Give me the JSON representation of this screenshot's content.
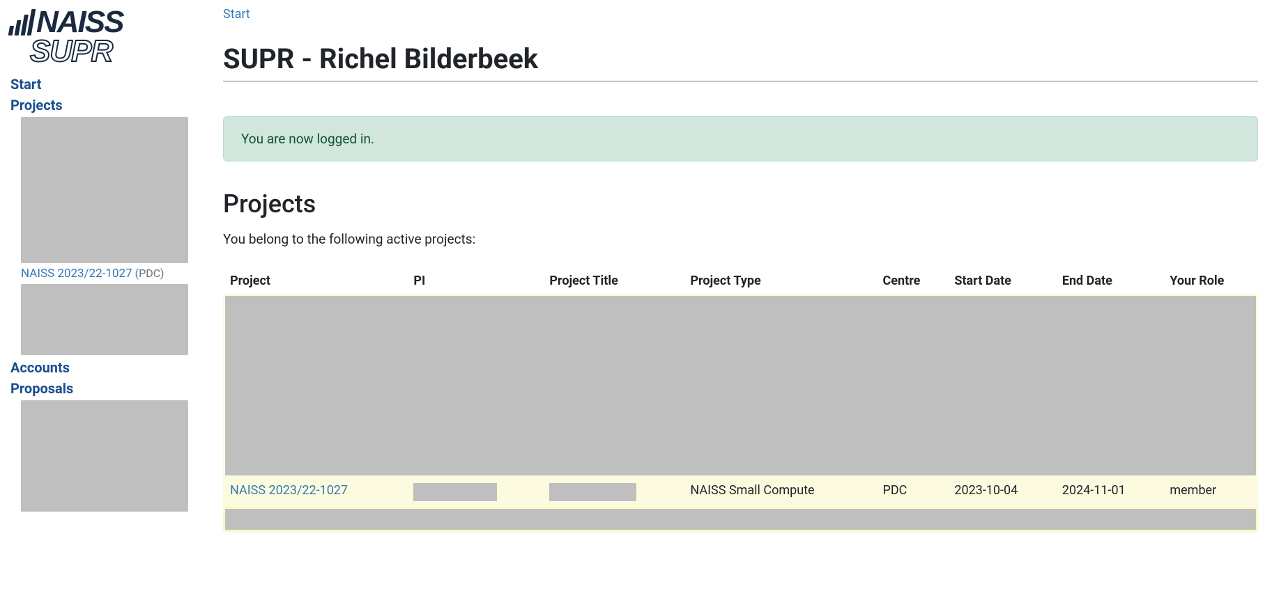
{
  "breadcrumb": {
    "start": "Start"
  },
  "header": {
    "title": "SUPR - Richel Bilderbeek"
  },
  "alert": {
    "message": "You are now logged in."
  },
  "sidebar": {
    "nav_start": "Start",
    "nav_projects": "Projects",
    "project_link": "NAISS 2023/22-1027",
    "project_suffix": "(PDC)",
    "nav_accounts": "Accounts",
    "nav_proposals": "Proposals"
  },
  "projects": {
    "title": "Projects",
    "description": "You belong to the following active projects:",
    "columns": {
      "project": "Project",
      "pi": "PI",
      "title": "Project Title",
      "type": "Project Type",
      "centre": "Centre",
      "start": "Start Date",
      "end": "End Date",
      "role": "Your Role"
    },
    "rows": [
      {
        "project": "NAISS 2023/22-1027",
        "pi": "",
        "title": "",
        "type": "NAISS Small Compute",
        "centre": "PDC",
        "start": "2023-10-04",
        "end": "2024-11-01",
        "role": "member"
      }
    ]
  }
}
